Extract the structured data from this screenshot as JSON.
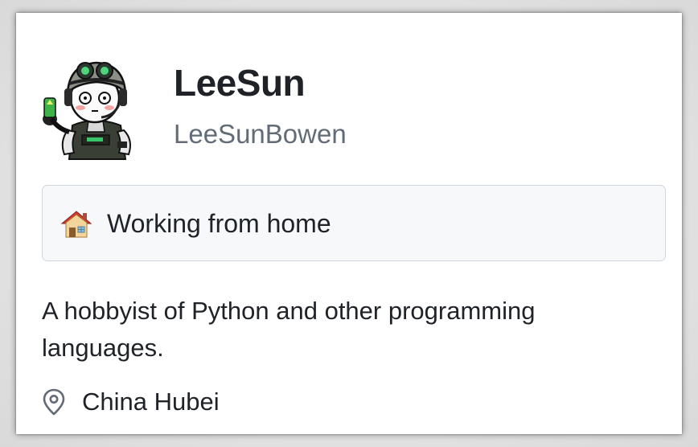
{
  "profile": {
    "name": "LeeSun",
    "login": "LeeSunBowen",
    "avatar_icon": "cartoon-soldier-avatar-icon"
  },
  "status": {
    "emoji_icon": "house-icon",
    "text": "Working from home"
  },
  "bio": "A hobbyist of Python and other programming languages.",
  "location": {
    "icon": "location-pin-icon",
    "text": "China Hubei"
  },
  "colors": {
    "text_primary": "#1f2328",
    "text_secondary": "#636c76",
    "status_bg": "#f6f8fa",
    "status_border": "#d0d7de"
  }
}
